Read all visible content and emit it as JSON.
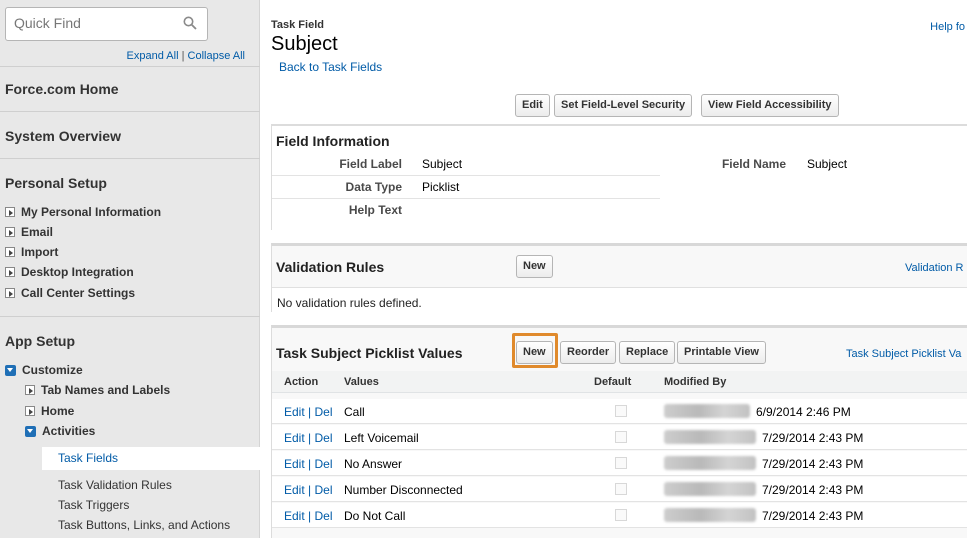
{
  "sidebar": {
    "quick_find_placeholder": "Quick Find",
    "expand_all": "Expand All",
    "collapse_all": "Collapse All",
    "link_divider": "|",
    "force_home": "Force.com Home",
    "system_overview": "System Overview",
    "personal_setup": {
      "title": "Personal Setup",
      "items": [
        "My Personal Information",
        "Email",
        "Import",
        "Desktop Integration",
        "Call Center Settings"
      ]
    },
    "app_setup": {
      "title": "App Setup",
      "customize": "Customize",
      "tab_names": "Tab Names and Labels",
      "home": "Home",
      "activities": "Activities",
      "activities_items": [
        "Task Fields",
        "Task Validation Rules",
        "Task Triggers",
        "Task Buttons, Links, and Actions"
      ]
    }
  },
  "header": {
    "crumb": "Task Field",
    "title": "Subject",
    "back_link": "Back to Task Fields",
    "help_link": "Help fo"
  },
  "actions": {
    "edit": "Edit",
    "set_fls": "Set Field-Level Security",
    "view_access": "View Field Accessibility"
  },
  "field_info": {
    "title": "Field Information",
    "field_label_label": "Field Label",
    "field_label_value": "Subject",
    "data_type_label": "Data Type",
    "data_type_value": "Picklist",
    "help_text_label": "Help Text",
    "field_name_label": "Field Name",
    "field_name_value": "Subject"
  },
  "validation": {
    "title": "Validation Rules",
    "new": "New",
    "help_link": "Validation R",
    "empty": "No validation rules defined."
  },
  "picklist": {
    "title": "Task Subject Picklist Values",
    "buttons": {
      "new": "New",
      "reorder": "Reorder",
      "replace": "Replace",
      "printable": "Printable View"
    },
    "help_link": "Task Subject Picklist Va",
    "columns": [
      "Action",
      "Values",
      "Default",
      "Modified By"
    ],
    "edit": "Edit",
    "divider": "|",
    "del": "Del",
    "rows": [
      {
        "value": "Call",
        "modified": "6/9/2014 2:46 PM"
      },
      {
        "value": "Left Voicemail",
        "modified": "7/29/2014 2:43 PM"
      },
      {
        "value": "No Answer",
        "modified": "7/29/2014 2:43 PM"
      },
      {
        "value": "Number Disconnected",
        "modified": "7/29/2014 2:43 PM"
      },
      {
        "value": "Do Not Call",
        "modified": "7/29/2014 2:43 PM"
      }
    ]
  },
  "colors": {
    "link": "#015ba7",
    "highlight": "#e08a2c",
    "tree_blue": "#1f6fb6"
  }
}
